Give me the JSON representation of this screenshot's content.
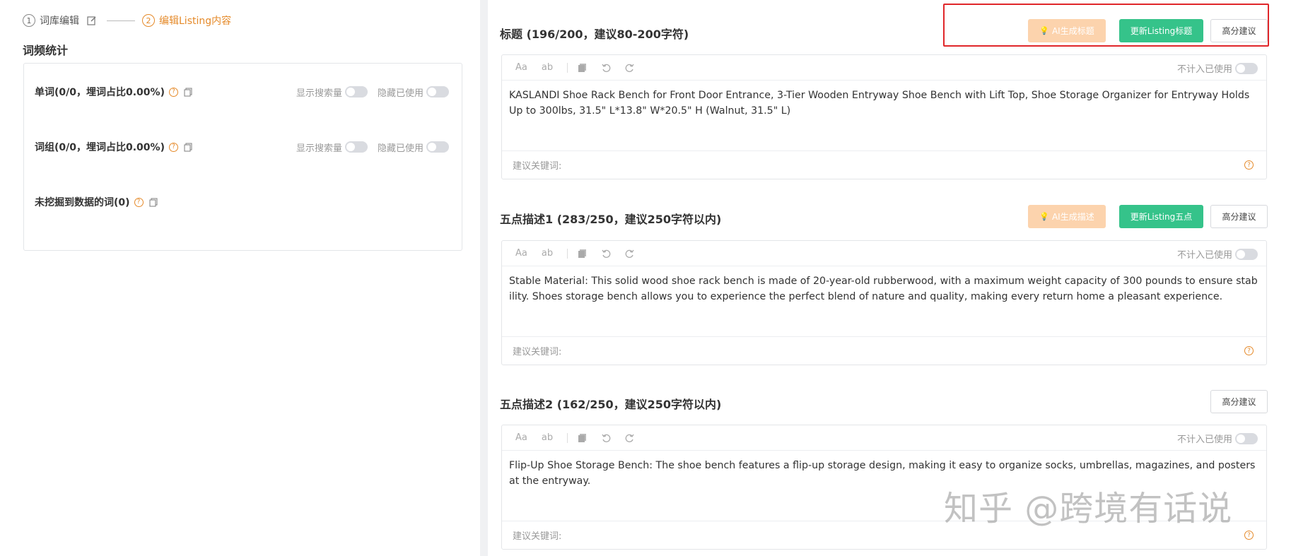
{
  "stepper": {
    "step1_num": "1",
    "step1_label": "词库编辑",
    "step2_num": "2",
    "step2_label": "编辑Listing内容"
  },
  "stats": {
    "title": "词频统计",
    "rows": [
      {
        "label": "单词(0/0，埋词占比0.00%)",
        "show_search": "显示搜索量",
        "hide_used": "隐藏已使用"
      },
      {
        "label": "词组(0/0，埋词占比0.00%)",
        "show_search": "显示搜索量",
        "hide_used": "隐藏已使用"
      },
      {
        "label": "未挖掘到数据的词(0)"
      }
    ]
  },
  "toolbar": {
    "aa": "Aa",
    "ab": "ab",
    "exclude_used": "不计入已使用"
  },
  "fields": [
    {
      "title": "标题 (196/200，建议80-200字符)",
      "ai_label": "AI生成标题",
      "update_label": "更新Listing标题",
      "score_label": "高分建议",
      "content": "KASLANDI Shoe Rack Bench for Front Door Entrance, 3-Tier Wooden Entryway Shoe Bench with Lift Top, Shoe Storage Organizer for Entryway Holds Up to 300lbs, 31.5\" L*13.8\" W*20.5\" H (Walnut, 31.5\" L)",
      "keywords_label": "建议关键词:"
    },
    {
      "title": "五点描述1 (283/250，建议250字符以内)",
      "ai_label": "AI生成描述",
      "update_label": "更新Listing五点",
      "score_label": "高分建议",
      "content": "Stable Material: This solid wood shoe rack bench is made of 20-year-old rubberwood, with a maximum weight capacity of 300 pounds to ensure stability. Shoes storage bench allows you to experience the perfect blend of nature and quality, making every return home a pleasant experience.",
      "keywords_label": "建议关键词:"
    },
    {
      "title": "五点描述2 (162/250，建议250字符以内)",
      "score_label": "高分建议",
      "content": "Flip-Up Shoe Storage Bench: The shoe bench features a flip-up storage design, making it easy to organize socks, umbrellas, magazines, and posters at the entryway.",
      "keywords_label": "建议关键词:"
    }
  ],
  "watermark": "知乎 @跨境有话说",
  "colors": {
    "accent_orange": "#e58a2a",
    "green": "#35c38a",
    "ai_disabled": "#fcd3ad",
    "highlight_red": "#e0262a"
  }
}
